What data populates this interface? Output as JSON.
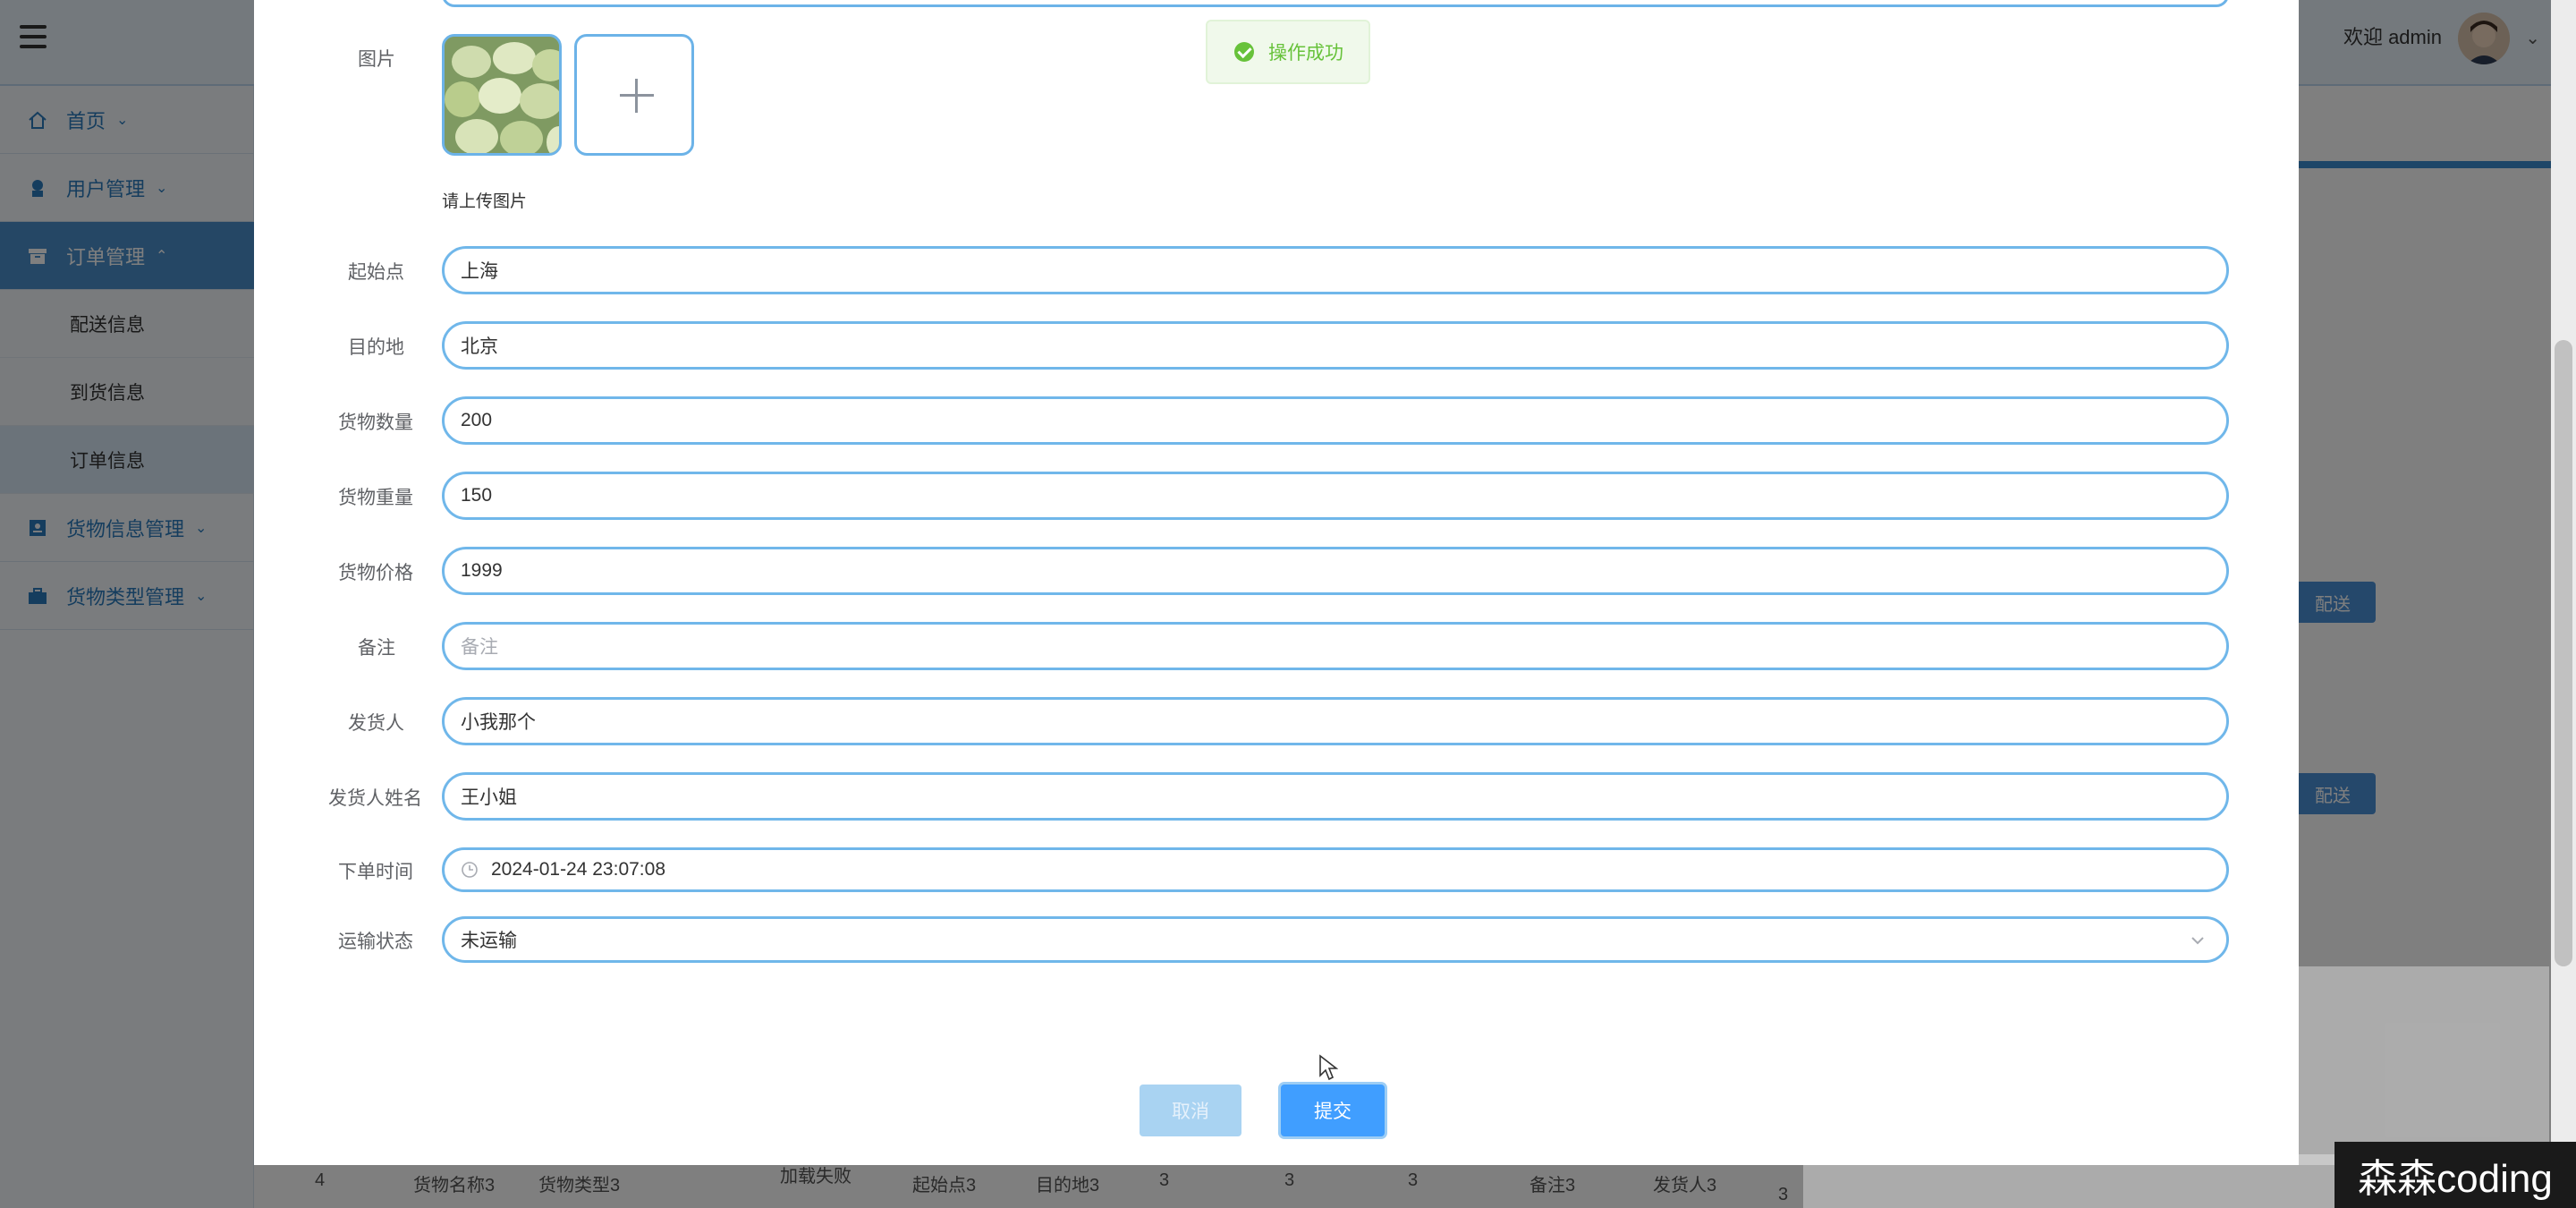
{
  "topbar": {
    "welcome": "欢迎 admin",
    "menu_icon": "hamburger-icon",
    "avatar_icon": "user-avatar",
    "caret_icon": "chevron-down-icon"
  },
  "sidebar": {
    "items": [
      {
        "label": "首页",
        "icon": "home-icon"
      },
      {
        "label": "用户管理",
        "icon": "user-badge-icon"
      },
      {
        "label": "订单管理",
        "icon": "archive-box-icon"
      },
      {
        "label": "货物信息管理",
        "icon": "id-card-icon"
      },
      {
        "label": "货物类型管理",
        "icon": "toolbox-icon"
      }
    ],
    "subitems": [
      {
        "label": "配送信息"
      },
      {
        "label": "到货信息"
      },
      {
        "label": "订单信息"
      }
    ]
  },
  "background": {
    "row_buttons": [
      "配送",
      "配送"
    ],
    "table_row": [
      "4",
      "货物名称3",
      "货物类型3",
      "加载失败",
      "起始点3",
      "目的地3",
      "3",
      "3",
      "3",
      "备注3",
      "发货人3",
      "3"
    ]
  },
  "toast": {
    "text": "操作成功",
    "icon": "success-check-icon"
  },
  "form": {
    "image_label": "图片",
    "upload_hint": "请上传图片",
    "upload_icon": "plus-icon",
    "fields": [
      {
        "label": "起始点",
        "value": "上海",
        "placeholder": ""
      },
      {
        "label": "目的地",
        "value": "北京",
        "placeholder": ""
      },
      {
        "label": "货物数量",
        "value": "200",
        "placeholder": ""
      },
      {
        "label": "货物重量",
        "value": "150",
        "placeholder": ""
      },
      {
        "label": "货物价格",
        "value": "1999",
        "placeholder": ""
      },
      {
        "label": "备注",
        "value": "",
        "placeholder": "备注"
      },
      {
        "label": "发货人",
        "value": "小我那个",
        "placeholder": ""
      },
      {
        "label": "发货人姓名",
        "value": "王小姐",
        "placeholder": ""
      },
      {
        "label": "下单时间",
        "value": "2024-01-24 23:07:08",
        "placeholder": ""
      },
      {
        "label": "运输状态",
        "value": "未运输",
        "placeholder": ""
      }
    ],
    "cancel_label": "取消",
    "submit_label": "提交"
  },
  "watermark": "森森coding",
  "colors": {
    "accent": "#409eff",
    "success": "#67c23a",
    "border": "#70b7ea"
  }
}
